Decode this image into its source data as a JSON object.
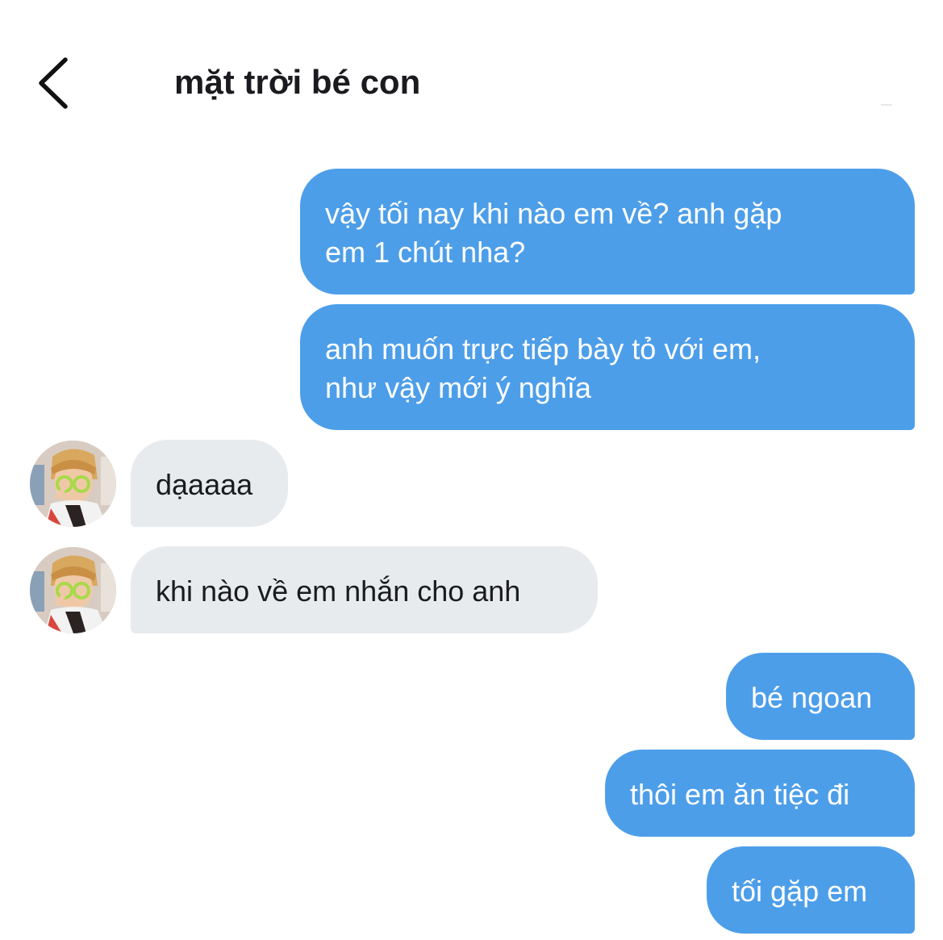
{
  "header": {
    "back_icon": "chevron-left-icon",
    "title": "mặt trời bé con"
  },
  "colors": {
    "outgoing_bubble": "#4d9ee9",
    "incoming_bubble": "#e7ebee",
    "outgoing_text": "#ffffff",
    "incoming_text": "#1b1b1f"
  },
  "messages": [
    {
      "direction": "outgoing",
      "lines": [
        "vậy tối nay khi nào em về? anh gặp",
        "em 1 chút nha?"
      ]
    },
    {
      "direction": "outgoing",
      "lines": [
        "anh muốn trực tiếp bày tỏ với em,",
        "như vậy mới ý nghĩa"
      ]
    },
    {
      "direction": "incoming",
      "lines": [
        "dạaaaa"
      ]
    },
    {
      "direction": "incoming",
      "lines": [
        "khi nào về em nhắn cho anh"
      ]
    },
    {
      "direction": "outgoing",
      "lines": [
        "bé ngoan"
      ]
    },
    {
      "direction": "outgoing",
      "lines": [
        "thôi em ăn tiệc đi"
      ]
    },
    {
      "direction": "outgoing",
      "lines": [
        "tối gặp em"
      ]
    }
  ]
}
